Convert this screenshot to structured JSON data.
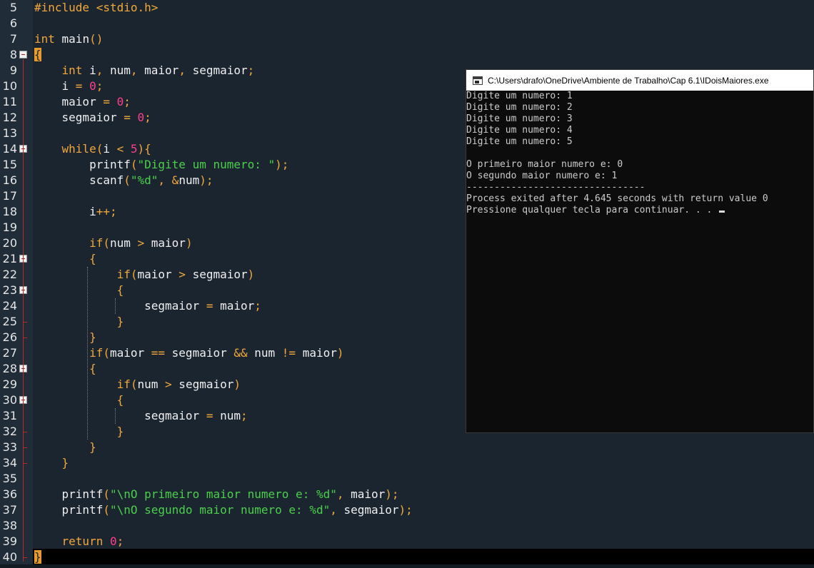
{
  "editor": {
    "lines": [
      {
        "n": "5",
        "tokens": [
          {
            "t": "#include <stdio.h>",
            "c": "pp"
          }
        ]
      },
      {
        "n": "6",
        "tokens": []
      },
      {
        "n": "7",
        "tokens": [
          {
            "t": "int",
            "c": "kw"
          },
          {
            "t": " main",
            "c": "plain"
          },
          {
            "t": "()",
            "c": "br"
          }
        ]
      },
      {
        "n": "8",
        "tokens": [
          {
            "t": "{",
            "c": "brace-hl"
          }
        ]
      },
      {
        "n": "9",
        "tokens": [
          {
            "t": "    "
          },
          {
            "t": "int",
            "c": "kw"
          },
          {
            "t": " i",
            "c": "plain"
          },
          {
            "t": ",",
            "c": "op"
          },
          {
            "t": " num",
            "c": "plain"
          },
          {
            "t": ",",
            "c": "op"
          },
          {
            "t": " maior",
            "c": "plain"
          },
          {
            "t": ",",
            "c": "op"
          },
          {
            "t": " segmaior",
            "c": "plain"
          },
          {
            "t": ";",
            "c": "op"
          }
        ]
      },
      {
        "n": "10",
        "tokens": [
          {
            "t": "    i ",
            "c": "plain"
          },
          {
            "t": "=",
            "c": "op"
          },
          {
            "t": " "
          },
          {
            "t": "0",
            "c": "num"
          },
          {
            "t": ";",
            "c": "op"
          }
        ]
      },
      {
        "n": "11",
        "tokens": [
          {
            "t": "    maior ",
            "c": "plain"
          },
          {
            "t": "=",
            "c": "op"
          },
          {
            "t": " "
          },
          {
            "t": "0",
            "c": "num"
          },
          {
            "t": ";",
            "c": "op"
          }
        ]
      },
      {
        "n": "12",
        "tokens": [
          {
            "t": "    segmaior ",
            "c": "plain"
          },
          {
            "t": "=",
            "c": "op"
          },
          {
            "t": " "
          },
          {
            "t": "0",
            "c": "num"
          },
          {
            "t": ";",
            "c": "op"
          }
        ]
      },
      {
        "n": "13",
        "tokens": []
      },
      {
        "n": "14",
        "tokens": [
          {
            "t": "    "
          },
          {
            "t": "while",
            "c": "kw"
          },
          {
            "t": "(",
            "c": "br"
          },
          {
            "t": "i ",
            "c": "plain"
          },
          {
            "t": "<",
            "c": "op"
          },
          {
            "t": " "
          },
          {
            "t": "5",
            "c": "num"
          },
          {
            "t": "){",
            "c": "br"
          }
        ]
      },
      {
        "n": "15",
        "tokens": [
          {
            "t": "        printf",
            "c": "plain"
          },
          {
            "t": "(",
            "c": "br"
          },
          {
            "t": "\"Digite um numero: \"",
            "c": "str"
          },
          {
            "t": ");",
            "c": "op"
          }
        ]
      },
      {
        "n": "16",
        "tokens": [
          {
            "t": "        scanf",
            "c": "plain"
          },
          {
            "t": "(",
            "c": "br"
          },
          {
            "t": "\"%d\"",
            "c": "str"
          },
          {
            "t": ", ",
            "c": "op"
          },
          {
            "t": "&",
            "c": "op"
          },
          {
            "t": "num",
            "c": "plain"
          },
          {
            "t": ");",
            "c": "op"
          }
        ]
      },
      {
        "n": "17",
        "tokens": []
      },
      {
        "n": "18",
        "tokens": [
          {
            "t": "        i",
            "c": "plain"
          },
          {
            "t": "++;",
            "c": "op"
          }
        ]
      },
      {
        "n": "19",
        "tokens": []
      },
      {
        "n": "20",
        "tokens": [
          {
            "t": "        "
          },
          {
            "t": "if",
            "c": "kw"
          },
          {
            "t": "(",
            "c": "br"
          },
          {
            "t": "num ",
            "c": "plain"
          },
          {
            "t": ">",
            "c": "op"
          },
          {
            "t": " maior",
            "c": "plain"
          },
          {
            "t": ")",
            "c": "br"
          }
        ]
      },
      {
        "n": "21",
        "tokens": [
          {
            "t": "        "
          },
          {
            "t": "{",
            "c": "br"
          }
        ]
      },
      {
        "n": "22",
        "tokens": [
          {
            "t": "            "
          },
          {
            "t": "if",
            "c": "kw"
          },
          {
            "t": "(",
            "c": "br"
          },
          {
            "t": "maior ",
            "c": "plain"
          },
          {
            "t": ">",
            "c": "op"
          },
          {
            "t": " segmaior",
            "c": "plain"
          },
          {
            "t": ")",
            "c": "br"
          }
        ]
      },
      {
        "n": "23",
        "tokens": [
          {
            "t": "            "
          },
          {
            "t": "{",
            "c": "br"
          }
        ]
      },
      {
        "n": "24",
        "tokens": [
          {
            "t": "                segmaior ",
            "c": "plain"
          },
          {
            "t": "=",
            "c": "op"
          },
          {
            "t": " maior",
            "c": "plain"
          },
          {
            "t": ";",
            "c": "op"
          }
        ]
      },
      {
        "n": "25",
        "tokens": [
          {
            "t": "            "
          },
          {
            "t": "}",
            "c": "br"
          }
        ]
      },
      {
        "n": "26",
        "tokens": [
          {
            "t": "        "
          },
          {
            "t": "}",
            "c": "br"
          }
        ]
      },
      {
        "n": "27",
        "tokens": [
          {
            "t": "        "
          },
          {
            "t": "if",
            "c": "kw"
          },
          {
            "t": "(",
            "c": "br"
          },
          {
            "t": "maior ",
            "c": "plain"
          },
          {
            "t": "==",
            "c": "op"
          },
          {
            "t": " segmaior ",
            "c": "plain"
          },
          {
            "t": "&&",
            "c": "op"
          },
          {
            "t": " num ",
            "c": "plain"
          },
          {
            "t": "!=",
            "c": "op"
          },
          {
            "t": " maior",
            "c": "plain"
          },
          {
            "t": ")",
            "c": "br"
          }
        ]
      },
      {
        "n": "28",
        "tokens": [
          {
            "t": "        "
          },
          {
            "t": "{",
            "c": "br"
          }
        ]
      },
      {
        "n": "29",
        "tokens": [
          {
            "t": "            "
          },
          {
            "t": "if",
            "c": "kw"
          },
          {
            "t": "(",
            "c": "br"
          },
          {
            "t": "num ",
            "c": "plain"
          },
          {
            "t": ">",
            "c": "op"
          },
          {
            "t": " segmaior",
            "c": "plain"
          },
          {
            "t": ")",
            "c": "br"
          }
        ]
      },
      {
        "n": "30",
        "tokens": [
          {
            "t": "            "
          },
          {
            "t": "{",
            "c": "br"
          }
        ]
      },
      {
        "n": "31",
        "tokens": [
          {
            "t": "                segmaior ",
            "c": "plain"
          },
          {
            "t": "=",
            "c": "op"
          },
          {
            "t": " num",
            "c": "plain"
          },
          {
            "t": ";",
            "c": "op"
          }
        ]
      },
      {
        "n": "32",
        "tokens": [
          {
            "t": "            "
          },
          {
            "t": "}",
            "c": "br"
          }
        ]
      },
      {
        "n": "33",
        "tokens": [
          {
            "t": "        "
          },
          {
            "t": "}",
            "c": "br"
          }
        ]
      },
      {
        "n": "34",
        "tokens": [
          {
            "t": "    "
          },
          {
            "t": "}",
            "c": "br"
          }
        ]
      },
      {
        "n": "35",
        "tokens": []
      },
      {
        "n": "36",
        "tokens": [
          {
            "t": "    printf",
            "c": "plain"
          },
          {
            "t": "(",
            "c": "br"
          },
          {
            "t": "\"\\nO primeiro maior numero e: %d\"",
            "c": "str"
          },
          {
            "t": ", ",
            "c": "op"
          },
          {
            "t": "maior",
            "c": "plain"
          },
          {
            "t": ");",
            "c": "op"
          }
        ]
      },
      {
        "n": "37",
        "tokens": [
          {
            "t": "    printf",
            "c": "plain"
          },
          {
            "t": "(",
            "c": "br"
          },
          {
            "t": "\"\\nO segundo maior numero e: %d\"",
            "c": "str"
          },
          {
            "t": ", ",
            "c": "op"
          },
          {
            "t": "segmaior",
            "c": "plain"
          },
          {
            "t": ");",
            "c": "op"
          }
        ]
      },
      {
        "n": "38",
        "tokens": []
      },
      {
        "n": "39",
        "tokens": [
          {
            "t": "    "
          },
          {
            "t": "return",
            "c": "kw"
          },
          {
            "t": " "
          },
          {
            "t": "0",
            "c": "num"
          },
          {
            "t": ";",
            "c": "op"
          }
        ]
      },
      {
        "n": "40",
        "tokens": [
          {
            "t": "}",
            "c": "brace-hl"
          }
        ]
      }
    ],
    "fold_lines": [
      "8",
      "14",
      "21",
      "23",
      "28",
      "30"
    ]
  },
  "console": {
    "title": "C:\\Users\\drafo\\OneDrive\\Ambiente de Trabalho\\Cap 6.1\\IDoisMaiores.exe",
    "icon": "console-window-icon",
    "lines": [
      "Digite um numero: 1",
      "Digite um numero: 2",
      "Digite um numero: 3",
      "Digite um numero: 4",
      "Digite um numero: 5",
      "",
      "O primeiro maior numero e: 0",
      "O segundo maior numero e: 1",
      "--------------------------------",
      "Process exited after 4.645 seconds with return value 0",
      "Pressione qualquer tecla para continuar. . . "
    ]
  }
}
